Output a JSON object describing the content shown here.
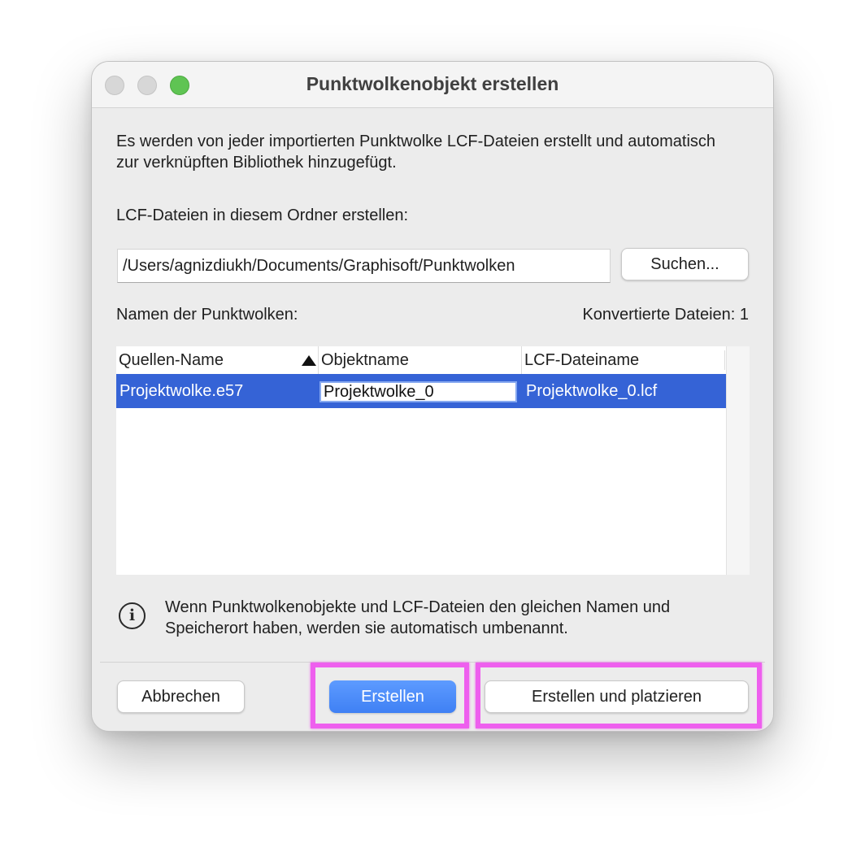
{
  "window": {
    "title": "Punktwolkenobjekt erstellen"
  },
  "description": "Es werden von jeder importierten Punktwolke LCF-Dateien erstellt und automatisch zur verknüpften Bibliothek hinzugefügt.",
  "folder": {
    "label": "LCF-Dateien in diesem Ordner erstellen:",
    "path": "/Users/agnizdiukh/Documents/Graphisoft/Punktwolken",
    "browse_label": "Suchen..."
  },
  "list": {
    "label": "Namen der Punktwolken:",
    "converted": "Konvertierte Dateien: 1",
    "columns": [
      "Quellen-Name",
      "Objektname",
      "LCF-Dateiname"
    ],
    "sort_icon": "sort-ascending-triangle-icon",
    "rows": [
      {
        "source": "Projektwolke.e57",
        "object": "Projektwolke_0",
        "lcf": "Projektwolke_0.lcf"
      }
    ]
  },
  "info": {
    "icon": "info-circle-icon",
    "text": "Wenn Punktwolkenobjekte und LCF-Dateien den gleichen Namen und Speicherort haben, werden sie automatisch umbenannt."
  },
  "buttons": {
    "cancel": "Abbrechen",
    "create": "Erstellen",
    "create_place": "Erstellen und platzieren"
  },
  "colors": {
    "selection": "#3563d6",
    "primary_button": "#4a8af7",
    "highlight_marker": "#ee5fee",
    "zoom_button": "#5fc453"
  }
}
